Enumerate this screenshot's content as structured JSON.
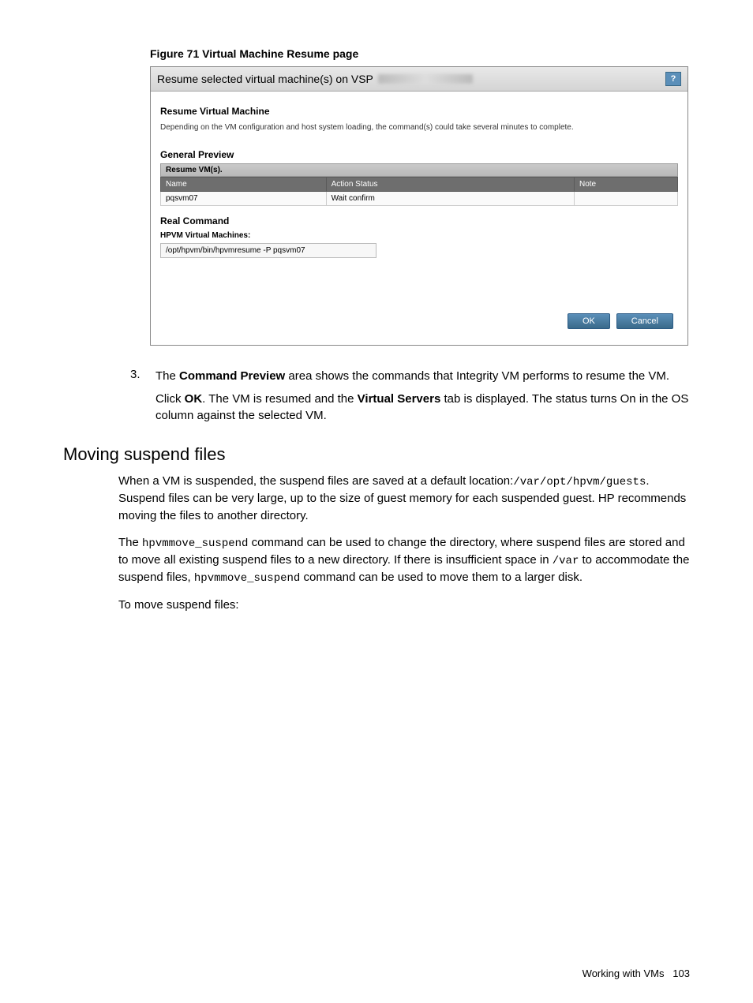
{
  "figure_caption": "Figure 71 Virtual Machine Resume page",
  "screenshot": {
    "title_prefix": "Resume selected virtual machine(s) on VSP",
    "help_icon": "?",
    "heading": "Resume Virtual Machine",
    "description": "Depending on the VM configuration and host system loading, the command(s) could take several minutes to complete.",
    "general_preview_title": "General Preview",
    "resume_vms_label": "Resume VM(s).",
    "table": {
      "headers": [
        "Name",
        "Action Status",
        "Note"
      ],
      "row": {
        "name": "pqsvm07",
        "status": "Wait confirm",
        "note": ""
      }
    },
    "real_command_title": "Real Command",
    "hpvm_label": "HPVM Virtual Machines:",
    "command_text": "/opt/hpvm/bin/hpvmresume -P pqsvm07",
    "ok_label": "OK",
    "cancel_label": "Cancel"
  },
  "step3": {
    "number": "3.",
    "line1a": "The ",
    "line1b": "Command Preview",
    "line1c": " area shows the commands that Integrity VM performs to resume the VM.",
    "line2a": "Click ",
    "line2b": "OK",
    "line2c": ". The VM is resumed and the ",
    "line2d": "Virtual Servers",
    "line2e": " tab is displayed. The status turns On in the OS column against the selected VM."
  },
  "moving_heading": "Moving suspend files",
  "para1a": "When a VM is suspended, the suspend files are saved at a default location:",
  "para1_path": "/var/opt/hpvm/guests",
  "para1b": ". Suspend files can be very large, up to the size of guest memory for each suspended guest. HP recommends moving the files to another directory.",
  "para2a": "The ",
  "para2_cmd1": "hpvmmove_suspend",
  "para2b": " command can be used to change the directory, where suspend files are stored and to move all existing suspend files to a new directory. If there is insufficient space in ",
  "para2_var": "/var",
  "para2c": " to accommodate the suspend files, ",
  "para2_cmd2": "hpvmmove_suspend",
  "para2d": " command can be used to move them to a larger disk.",
  "para3": "To move suspend files:",
  "footer_text": "Working with VMs",
  "footer_page": "103"
}
